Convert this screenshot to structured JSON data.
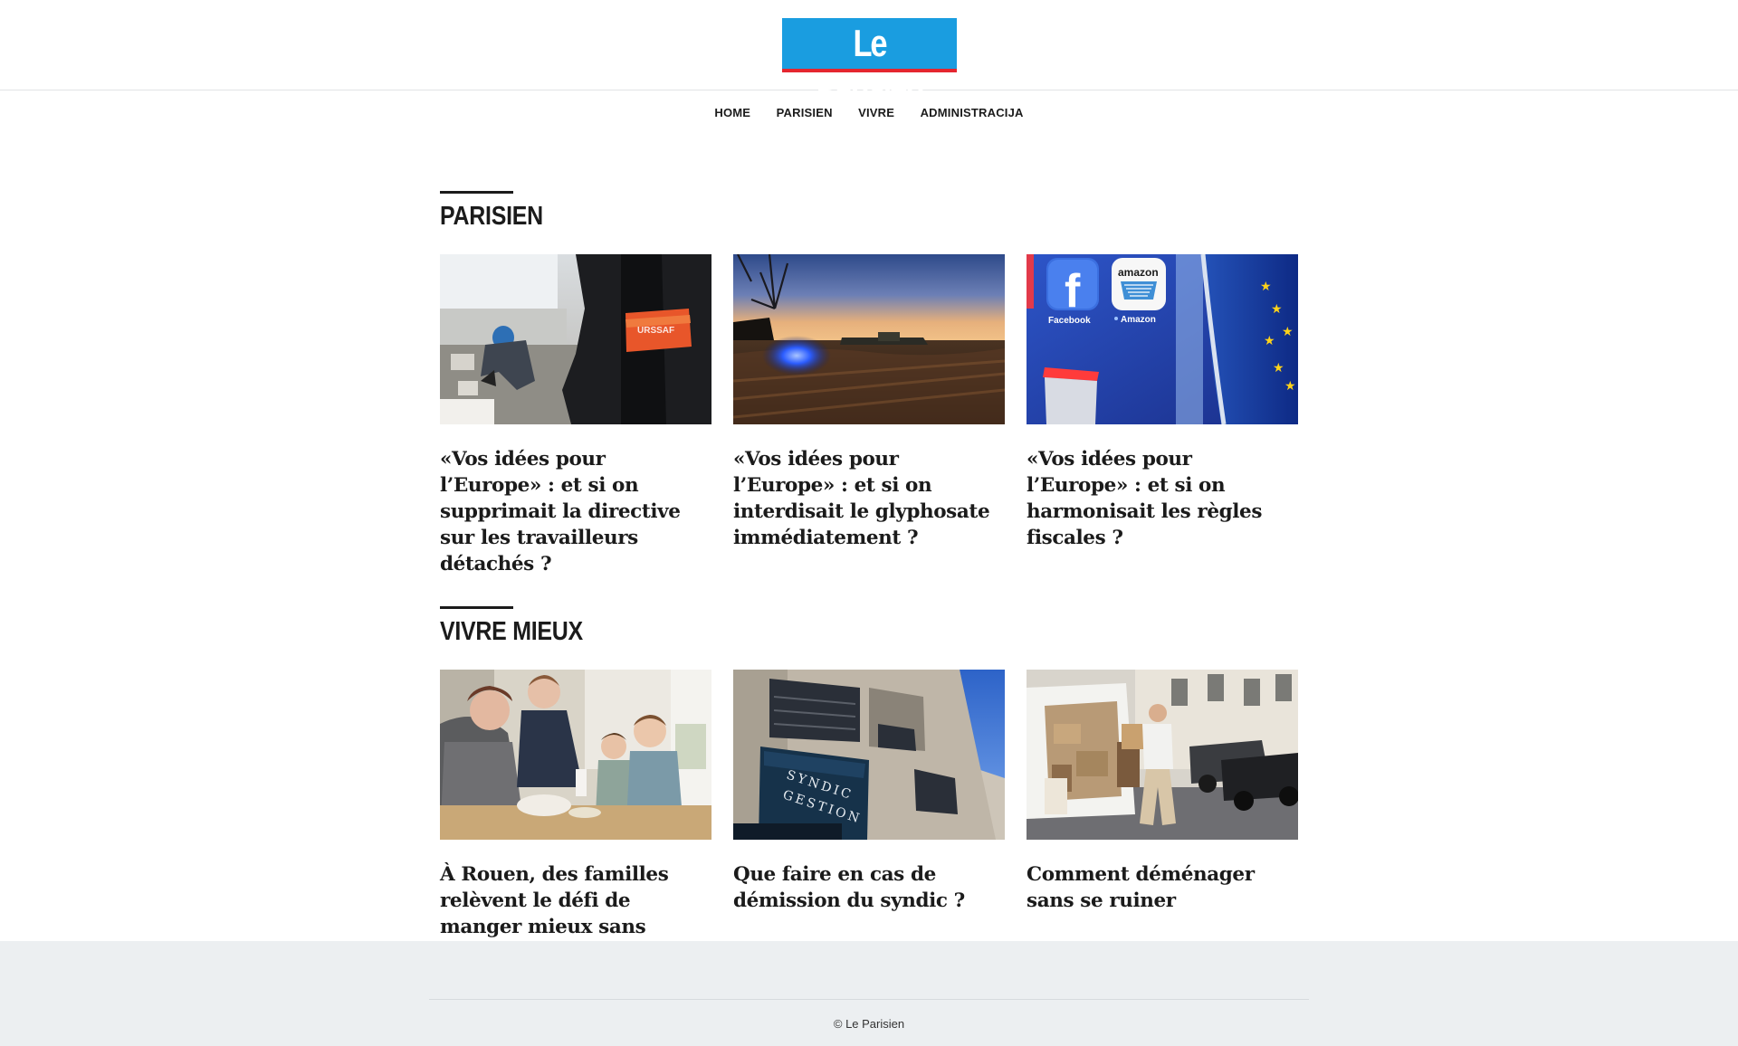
{
  "header": {
    "logo_text": "Le Parisien",
    "brand_color": "#1a9de0",
    "accent_color": "#e5262f"
  },
  "nav": {
    "items": [
      {
        "label": "HOME"
      },
      {
        "label": "PARISIEN"
      },
      {
        "label": "VIVRE"
      },
      {
        "label": "ADMINISTRACIJA"
      }
    ]
  },
  "sections": [
    {
      "title": "PARISIEN",
      "articles": [
        {
          "title": "«Vos idées pour l’Europe» : et si on supprimait la directive sur les travailleurs détachés ?",
          "image": "urssaf-inspector-photo"
        },
        {
          "title": "«Vos idées pour l’Europe» : et si on interdisait le glyphosate immédiatement ?",
          "image": "tractor-field-at-dusk-photo"
        },
        {
          "title": "«Vos idées pour l’Europe» : et si on harmonisait les règles fiscales ?",
          "image": "facebook-amazon-eu-flag-photo"
        }
      ]
    },
    {
      "title": "VIVRE MIEUX",
      "articles": [
        {
          "title": "À Rouen, des familles relèvent le défi de manger mieux sans dépenser plus",
          "image": "family-cooking-photo"
        },
        {
          "title": "Que faire en cas de démission du syndic ?",
          "image": "syndic-gestion-building-photo"
        },
        {
          "title": "Comment déménager sans se ruiner",
          "image": "moving-van-photo"
        }
      ]
    }
  ],
  "image_labels": {
    "urssaf": "URSSAF",
    "facebook": "Facebook",
    "amazon": "amazon",
    "amazon_caption": "Amazon",
    "syndic_line1": "SYNDIC",
    "syndic_line2": "GESTION"
  },
  "footer": {
    "copyright": "© Le Parisien"
  }
}
